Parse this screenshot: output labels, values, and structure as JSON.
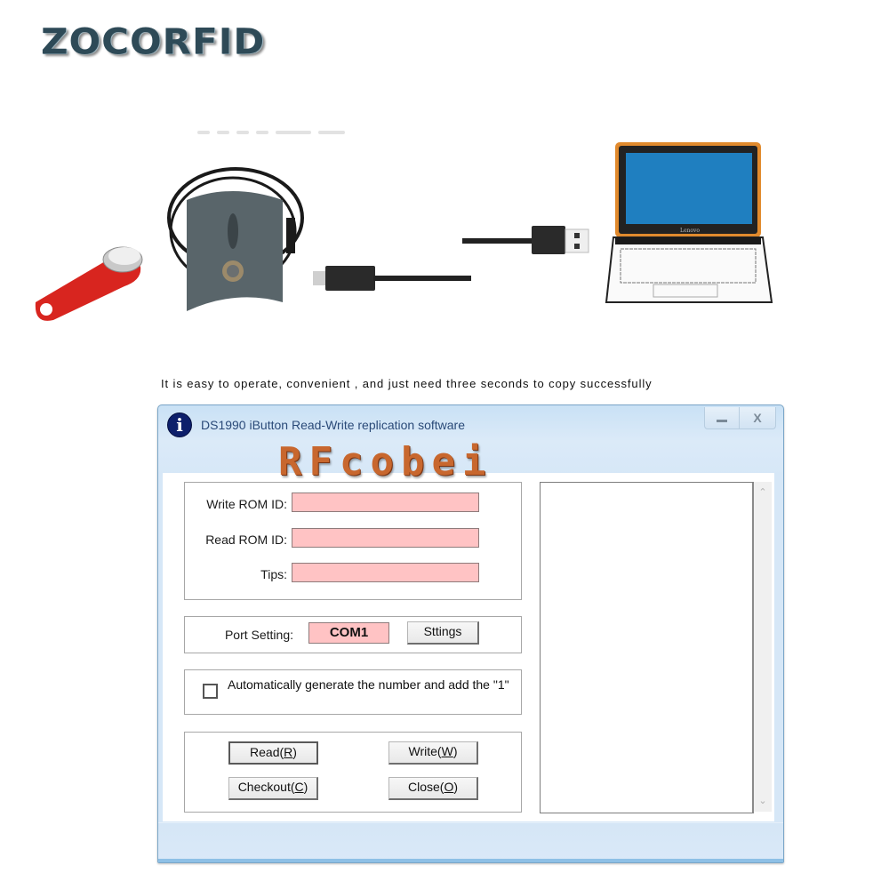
{
  "brand": {
    "logo_text": "ZOCORFID"
  },
  "illustration": {
    "items": [
      "ibutton-key",
      "ibutton-reader",
      "micro-usb-cable",
      "usb-a-cable",
      "laptop"
    ],
    "laptop_label": "Lenovo"
  },
  "caption": "It is easy to operate, convenient , and just need three seconds to copy successfully",
  "window": {
    "title": "DS1990 iButton Read-Write replication software",
    "icon": "info-icon",
    "controls": {
      "minimize": "minimize",
      "close": "X"
    },
    "watermark": "RFcobei"
  },
  "fields": [
    {
      "label": "Write ROM ID:",
      "value": ""
    },
    {
      "label": "Read ROM ID:",
      "value": ""
    },
    {
      "label": "Tips:",
      "value": ""
    }
  ],
  "port": {
    "label": "Port Setting:",
    "value": "COM1",
    "settings_button": "Sttings"
  },
  "auto_generate": {
    "checked": false,
    "label": "Automatically generate the number and add the \"1\""
  },
  "buttons": {
    "read": {
      "text": "Read(",
      "key": "R",
      "end": ")"
    },
    "write": {
      "text": "Write(",
      "key": "W",
      "end": ")"
    },
    "checkout": {
      "text": "Checkout(",
      "key": "C",
      "end": ")"
    },
    "close": {
      "text": "Close(",
      "key": "O",
      "end": ")"
    }
  },
  "log": {
    "content": ""
  },
  "colors": {
    "input_bg": "#ffc3c4",
    "title_text": "#2a4a78",
    "window_frame": "#c9e1f5",
    "watermark": "#c8672e"
  }
}
